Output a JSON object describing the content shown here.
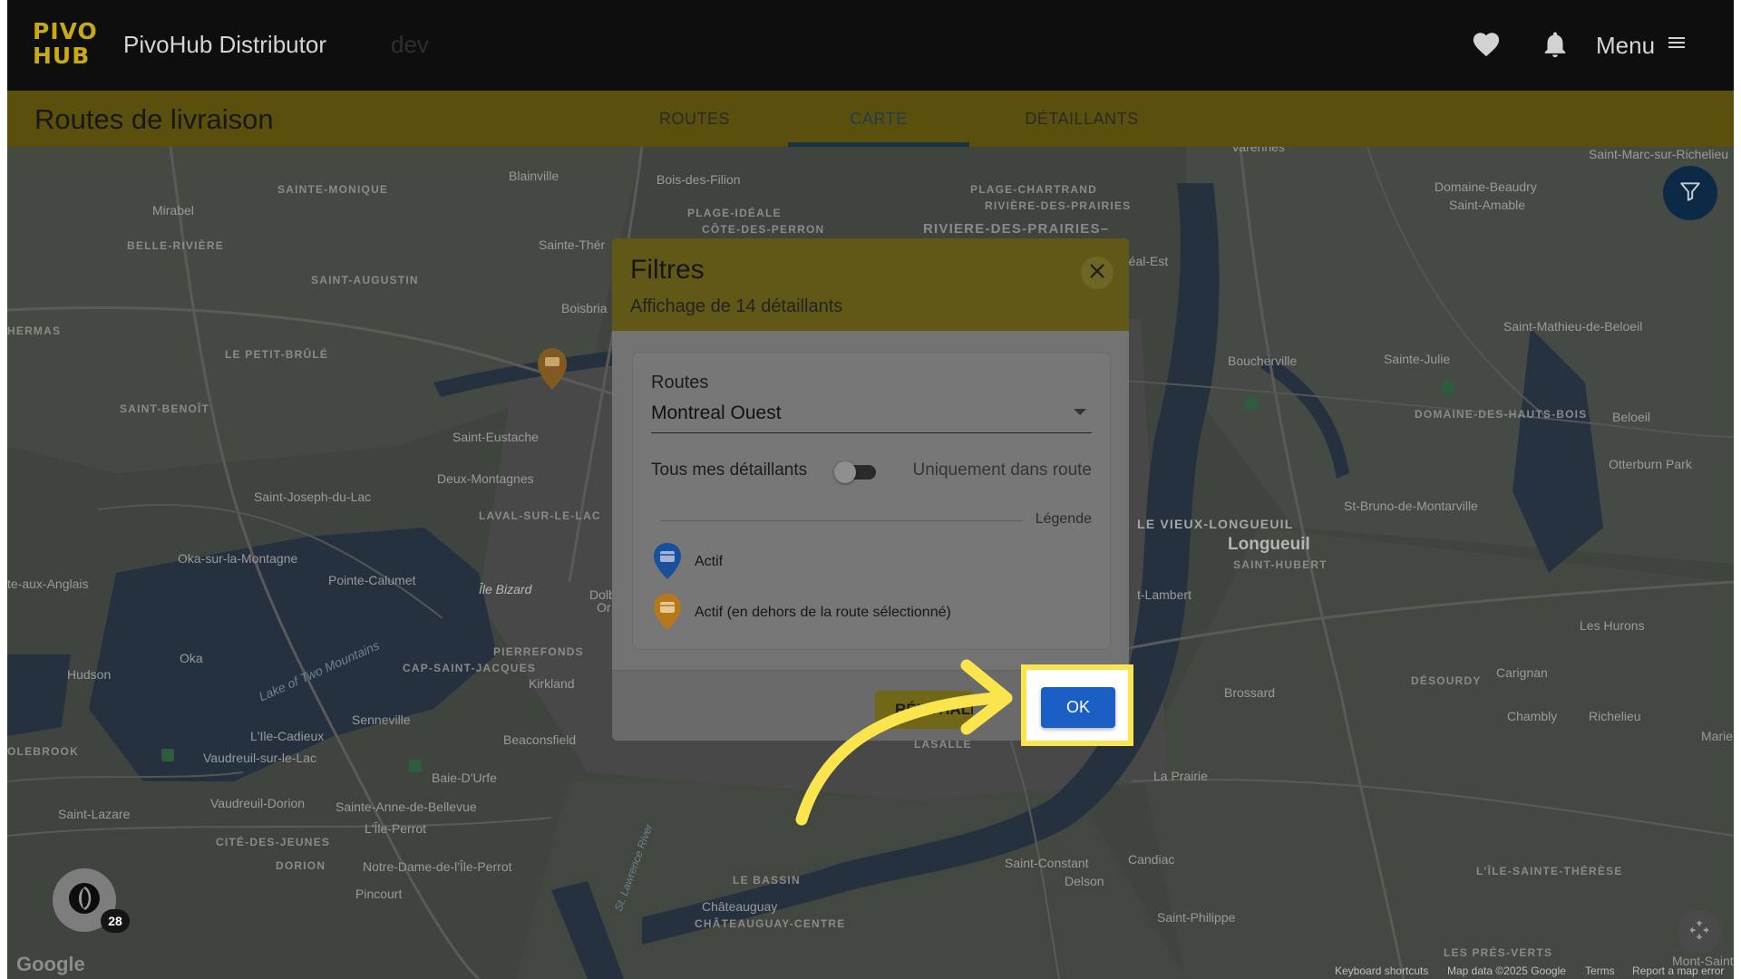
{
  "app": {
    "logo_line1": "PIVO",
    "logo_line2": "HUB",
    "title": "PivoHub Distributor",
    "env": "dev",
    "menu_label": "Menu"
  },
  "page": {
    "title": "Routes de livraison",
    "tabs": [
      {
        "label": "ROUTES",
        "active": false
      },
      {
        "label": "CARTE",
        "active": true
      },
      {
        "label": "DÉTAILLANTS",
        "active": false
      }
    ]
  },
  "map": {
    "labels": [
      {
        "text": "Blainville"
      },
      {
        "text": "Bois-des-Filion"
      },
      {
        "text": "Mirabel"
      },
      {
        "text": "SAINTE-MONIQUE"
      },
      {
        "text": "BELLE-RIVIÈRE"
      },
      {
        "text": "SAINT-AUGUSTIN"
      },
      {
        "text": "LE PETIT-BRÛLÉ"
      },
      {
        "text": "SAINT-BENOÎT"
      },
      {
        "text": "HERMAS"
      },
      {
        "text": "Saint-Eustache"
      },
      {
        "text": "Deux-Montagnes"
      },
      {
        "text": "Saint-Joseph-du-Lac"
      },
      {
        "text": "LAVAL-SUR-LE-LAC"
      },
      {
        "text": "Oka-sur-la-Montagne"
      },
      {
        "text": "Pointe-Calumet"
      },
      {
        "text": "Île Bizard"
      },
      {
        "text": "Oka"
      },
      {
        "text": "Hudson"
      },
      {
        "text": "Lake of Two Mountains"
      },
      {
        "text": "Senneville"
      },
      {
        "text": "L'Ile-Cadieux"
      },
      {
        "text": "Vaudreuil-sur-le-Lac"
      },
      {
        "text": "Vaudreuil-Dorion"
      },
      {
        "text": "Saint-Lazare"
      },
      {
        "text": "CITÉ-DES-JEUNES"
      },
      {
        "text": "DORION"
      },
      {
        "text": "Pincourt"
      },
      {
        "text": "Notre-Dame-de-l'Île-Perrot"
      },
      {
        "text": "L'Île-Perrot"
      },
      {
        "text": "Sainte-Anne-de-Bellevue"
      },
      {
        "text": "Baie-D'Urfe"
      },
      {
        "text": "Beaconsfield"
      },
      {
        "text": "Kirkland"
      },
      {
        "text": "PIERREFONDS"
      },
      {
        "text": "CAP-SAINT-JACQUES"
      },
      {
        "text": "OLEBROOK"
      },
      {
        "text": "te-aux-Anglais"
      },
      {
        "text": "PLAGE-IDÉALE"
      },
      {
        "text": "CÔTE-DES-PERRON"
      },
      {
        "text": "PLAGE-CHARTRAND"
      },
      {
        "text": "RIVIÈRE-DES-PRAIRIES"
      },
      {
        "text": "RIVIERE-DES-PRAIRIES–"
      },
      {
        "text": "Sainte-Thér"
      },
      {
        "text": "Boisbria"
      },
      {
        "text": "Varennes"
      },
      {
        "text": "réal-Est"
      },
      {
        "text": "Domaine-Beaudry"
      },
      {
        "text": "Saint-Amable"
      },
      {
        "text": "Saint-Marc-sur-Richelieu"
      },
      {
        "text": "Saint-Mathieu-de-Beloeil"
      },
      {
        "text": "Sainte-Julie"
      },
      {
        "text": "Boucherville"
      },
      {
        "text": "DOMAINE-DES-HAUTS-BOIS"
      },
      {
        "text": "Beloeil"
      },
      {
        "text": "Otterburn Park"
      },
      {
        "text": "St-Bruno-de-Montarville"
      },
      {
        "text": "LE VIEUX-LONGUEUIL"
      },
      {
        "text": "Longueuil"
      },
      {
        "text": "SAINT-HUBERT"
      },
      {
        "text": "t-Lambert"
      },
      {
        "text": "Les Hurons"
      },
      {
        "text": "DÉSOURDY"
      },
      {
        "text": "Carignan"
      },
      {
        "text": "Brossard"
      },
      {
        "text": "Chambly"
      },
      {
        "text": "Richelieu"
      },
      {
        "text": "Marie"
      },
      {
        "text": "La Prairie"
      },
      {
        "text": "Candiac"
      },
      {
        "text": "Saint-Constant"
      },
      {
        "text": "Delson"
      },
      {
        "text": "Saint-Philippe"
      },
      {
        "text": "L'ÎLE-SAINTE-THÉRÈSE"
      },
      {
        "text": "LES PRÉS-VERTS"
      },
      {
        "text": "Mont-Saint-G"
      },
      {
        "text": "LE BASSIN"
      },
      {
        "text": "Châteauguay"
      },
      {
        "text": "CHÂTEAUGUAY-CENTRE"
      },
      {
        "text": "LASALLE"
      },
      {
        "text": "Dolb"
      },
      {
        "text": "Or"
      },
      {
        "text": "St. Lawrence River"
      }
    ],
    "google_logo": "Google",
    "attribution": {
      "keyboard": "Keyboard shortcuts",
      "map_data": "Map data ©2025 Google",
      "terms": "Terms",
      "report": "Report a map error"
    },
    "badge_count": "28"
  },
  "modal": {
    "title": "Filtres",
    "subtitle": "Affichage de 14 détaillants",
    "routes_label": "Routes",
    "routes_value": "Montreal Ouest",
    "toggle_left": "Tous mes détaillants",
    "toggle_right": "Uniquement dans route",
    "toggle_on": false,
    "legend_title": "Légende",
    "legend": [
      {
        "label": "Actif",
        "color": "#1a4f9c"
      },
      {
        "label": "Actif (en dehors de la route sélectionné)",
        "color": "#b7771b"
      }
    ],
    "reset_label": "RÉINITIALISER",
    "ok_label": "OK"
  },
  "colors": {
    "brand_yellow": "#f4d21f",
    "dark_bar": "#0e0e0e",
    "primary_blue": "#1b5fc4",
    "highlight": "#fbe54f",
    "arrow": "#fbe54f"
  }
}
